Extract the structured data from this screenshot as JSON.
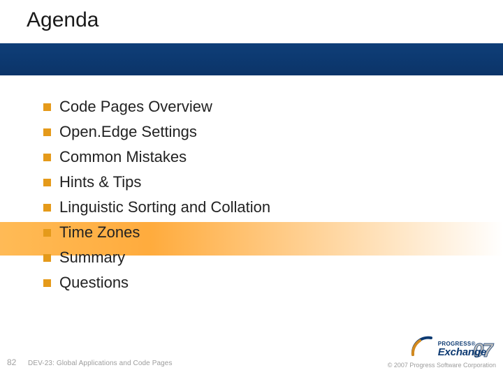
{
  "title": "Agenda",
  "bullets": [
    "Code Pages Overview",
    "Open.Edge Settings",
    "Common Mistakes",
    "Hints & Tips",
    "Linguistic Sorting and Collation",
    "Time Zones",
    "Summary",
    "Questions"
  ],
  "footer": {
    "slide_number": "82",
    "session": "DEV-23: Global Applications and Code Pages",
    "copyright": "© 2007 Progress Software Corporation"
  },
  "logo": {
    "top_text": "PROGRESS®",
    "main_text": "Exchange",
    "year": "07"
  },
  "colors": {
    "blue": "#0d3a72",
    "orange_bullet": "#e59a1a"
  }
}
